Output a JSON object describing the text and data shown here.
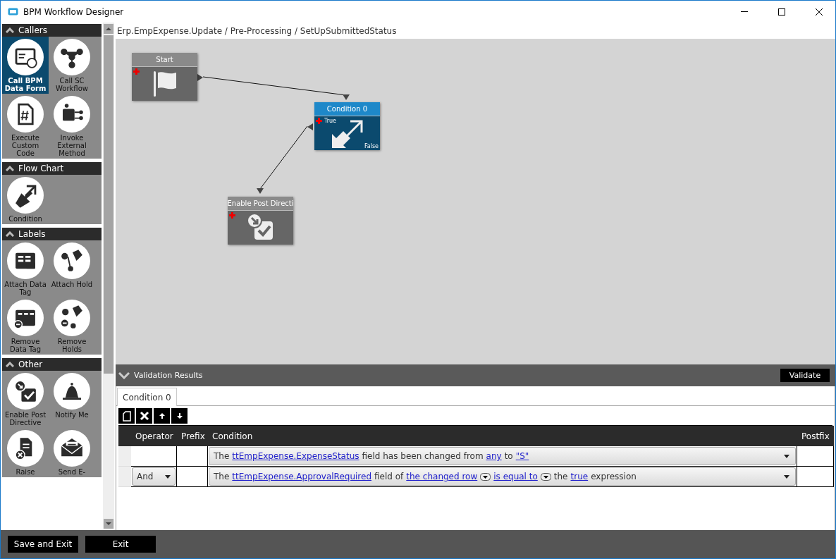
{
  "window": {
    "title": "BPM Workflow Designer"
  },
  "palette": [
    {
      "title": "Callers",
      "expanded": true,
      "items": [
        {
          "label": "Call BPM Data Form",
          "selected": true
        },
        {
          "label": "Call SC Workflow",
          "selected": false
        },
        {
          "label": "Execute Custom Code",
          "selected": false
        },
        {
          "label": "Invoke External Method",
          "selected": false
        }
      ]
    },
    {
      "title": "Flow Chart",
      "expanded": true,
      "items": [
        {
          "label": "Condition",
          "selected": false
        }
      ]
    },
    {
      "title": "Labels",
      "expanded": true,
      "items": [
        {
          "label": "Attach Data Tag",
          "selected": false
        },
        {
          "label": "Attach Hold",
          "selected": false
        },
        {
          "label": "Remove Data Tag",
          "selected": false
        },
        {
          "label": "Remove Holds",
          "selected": false
        }
      ]
    },
    {
      "title": "Other",
      "expanded": true,
      "items": [
        {
          "label": "Enable Post Directive",
          "selected": false
        },
        {
          "label": "Notify Me",
          "selected": false
        },
        {
          "label": "Raise",
          "selected": false
        },
        {
          "label": "Send E-",
          "selected": false
        }
      ]
    }
  ],
  "breadcrumb": "Erp.EmpExpense.Update / Pre-Processing / SetUpSubmittedStatus",
  "canvas": {
    "nodes": [
      {
        "kind": "start",
        "title": "Start",
        "selected": false
      },
      {
        "kind": "condition",
        "title": "Condition 0",
        "selected": true,
        "true_label": "True",
        "false_label": "False"
      },
      {
        "kind": "post",
        "title": "Enable Post Directi",
        "selected": false
      }
    ]
  },
  "validation": {
    "title": "Validation Results",
    "expanded": false,
    "button": "Validate"
  },
  "editor": {
    "tabs": [
      {
        "label": "Condition 0",
        "selected": true
      }
    ],
    "columns": [
      "Operator",
      "Prefix",
      "Condition",
      "Postfix"
    ],
    "rows": [
      {
        "operator": "",
        "segments": [
          {
            "kind": "text",
            "text": "The"
          },
          {
            "kind": "link",
            "text": "ttEmpExpense.ExpenseStatus"
          },
          {
            "kind": "text",
            "text": "field has been changed from"
          },
          {
            "kind": "link",
            "text": "any"
          },
          {
            "kind": "text",
            "text": "to"
          },
          {
            "kind": "link",
            "text": "\"S\""
          }
        ]
      },
      {
        "operator": "And",
        "segments": [
          {
            "kind": "text",
            "text": "The"
          },
          {
            "kind": "link",
            "text": "ttEmpExpense.ApprovalRequired"
          },
          {
            "kind": "text",
            "text": "field of"
          },
          {
            "kind": "menu",
            "text": "the changed row"
          },
          {
            "kind": "menu",
            "text": "is equal to"
          },
          {
            "kind": "text",
            "text": "the"
          },
          {
            "kind": "link",
            "text": "true"
          },
          {
            "kind": "text",
            "text": "expression"
          }
        ]
      }
    ]
  },
  "footer": {
    "buttons": [
      "Save and Exit",
      "Exit"
    ]
  }
}
